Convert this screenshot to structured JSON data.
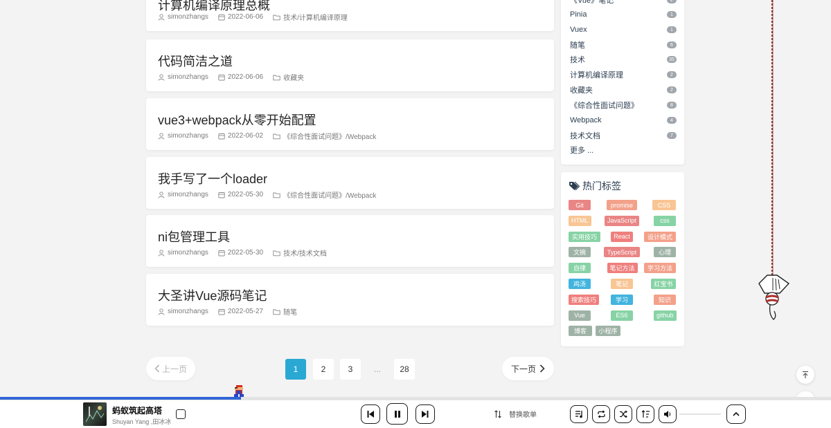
{
  "posts": [
    {
      "title": "计算机编译原理总概",
      "author": "simonzhangs",
      "date": "2022-06-06",
      "category": "技术/计算机编译原理"
    },
    {
      "title": "代码简洁之道",
      "author": "simonzhangs",
      "date": "2022-06-06",
      "category": "收藏夹"
    },
    {
      "title": "vue3+webpack从零开始配置",
      "author": "simonzhangs",
      "date": "2022-06-02",
      "category": "《综合性面试问题》/Webpack"
    },
    {
      "title": "我手写了一个loader",
      "author": "simonzhangs",
      "date": "2022-05-30",
      "category": "《综合性面试问题》/Webpack"
    },
    {
      "title": "ni包管理工具",
      "author": "simonzhangs",
      "date": "2022-05-30",
      "category": "技术/技术文档"
    },
    {
      "title": "大圣讲Vue源码笔记",
      "author": "simonzhangs",
      "date": "2022-05-27",
      "category": "随笔"
    }
  ],
  "categories": {
    "items": [
      {
        "name": "《Vue》笔记",
        "count": "2"
      },
      {
        "name": "Pinia",
        "count": "1"
      },
      {
        "name": "Vuex",
        "count": "1"
      },
      {
        "name": "随笔",
        "count": "6"
      },
      {
        "name": "技术",
        "count": "35"
      },
      {
        "name": "计算机编译原理",
        "count": "2"
      },
      {
        "name": "收藏夹",
        "count": "2"
      },
      {
        "name": "《综合性面试问题》",
        "count": "8"
      },
      {
        "name": "Webpack",
        "count": "4"
      },
      {
        "name": "技术文档",
        "count": "7"
      }
    ],
    "more": "更多 ..."
  },
  "hot_tags": {
    "title": "热门标签",
    "tags": [
      {
        "label": "Git",
        "color": "#e98584"
      },
      {
        "label": "promise",
        "color": "#f3a18a"
      },
      {
        "label": "CSS",
        "color": "#f8c594"
      },
      {
        "label": "HTML",
        "color": "#f8c594"
      },
      {
        "label": "JavaScript",
        "color": "#e98584"
      },
      {
        "label": "css",
        "color": "#87d3a5"
      },
      {
        "label": "实用技巧",
        "color": "#87d3a5"
      },
      {
        "label": "React",
        "color": "#ef7f7d"
      },
      {
        "label": "设计模式",
        "color": "#f3a18a"
      },
      {
        "label": "文摘",
        "color": "#9fb2a6"
      },
      {
        "label": "TypeScript",
        "color": "#e98584"
      },
      {
        "label": "心理",
        "color": "#9fb2a6"
      },
      {
        "label": "自律",
        "color": "#87d3a5"
      },
      {
        "label": "笔记方法",
        "color": "#ef7f7d"
      },
      {
        "label": "学习方法",
        "color": "#f3a18a"
      },
      {
        "label": "鸡汤",
        "color": "#42b4de"
      },
      {
        "label": "笔记",
        "color": "#f8c594"
      },
      {
        "label": "红宝书",
        "color": "#87d3a5"
      },
      {
        "label": "搜索技巧",
        "color": "#ef7f7d"
      },
      {
        "label": "学习",
        "color": "#42b4de"
      },
      {
        "label": "知识",
        "color": "#f3a18a"
      },
      {
        "label": "Vue",
        "color": "#9fb2a6"
      },
      {
        "label": "ES6",
        "color": "#87d3a5"
      },
      {
        "label": "github",
        "color": "#87d3a5"
      },
      {
        "label": "博客",
        "color": "#9fb2a6"
      },
      {
        "label": "小程序",
        "color": "#9fb2a6"
      }
    ]
  },
  "pagination": {
    "prev": "上一页",
    "next": "下一页",
    "pages": [
      "1",
      "2",
      "3",
      "...",
      "28"
    ],
    "current": "1"
  },
  "player": {
    "song": "蚂蚁筑起高塔",
    "artist": "Shuyan Yang ,田冰冰",
    "playlist_label": "替换歌单",
    "progress_fraction": 0.29,
    "accent_color": "#3266d6"
  }
}
